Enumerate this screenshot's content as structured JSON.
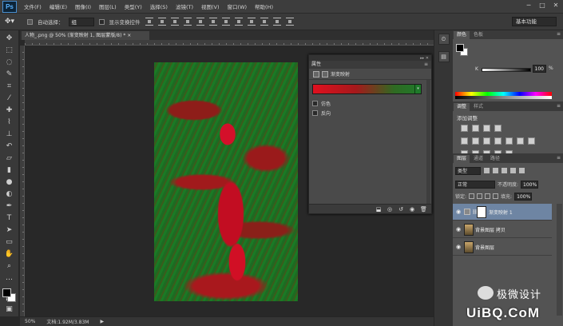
{
  "app": {
    "logo": "Ps"
  },
  "menu": [
    "文件(F)",
    "编辑(E)",
    "图像(I)",
    "图层(L)",
    "类型(Y)",
    "选择(S)",
    "滤镜(T)",
    "视图(V)",
    "窗口(W)",
    "帮助(H)"
  ],
  "window_controls": [
    "─",
    "□",
    "✕"
  ],
  "options": {
    "auto_select_label": "自动选择：",
    "auto_select_value": "组",
    "show_transform_label": "显示变换控件",
    "workspace": "基本功能"
  },
  "document": {
    "tab_title": "人物_.png @ 50% (渐变映射 1, 图层蒙版/8) * ×",
    "zoom": "50%",
    "doc_size": "文档:1.92M/3.83M"
  },
  "properties": {
    "panel_title": "属性",
    "adjustment_name": "渐变映射",
    "options": [
      {
        "label": "仿色",
        "checked": false
      },
      {
        "label": "反向",
        "checked": false
      }
    ],
    "gradient_colors": [
      "#e0101f",
      "#1f7a2a"
    ]
  },
  "color_panel": {
    "tabs": [
      "颜色",
      "色板"
    ],
    "channel_label": "K",
    "value": "100",
    "unit": "%"
  },
  "adjustments_panel": {
    "tabs": [
      "调整",
      "样式"
    ],
    "title": "添加调整"
  },
  "layers_panel": {
    "tabs": [
      "图层",
      "通道",
      "路径"
    ],
    "filter_kind": "类型",
    "blend_mode": "正常",
    "opacity_label": "不透明度:",
    "opacity_value": "100%",
    "lock_label": "锁定:",
    "fill_label": "填充:",
    "fill_value": "100%",
    "layers": [
      {
        "name": "渐变映射 1",
        "selected": true,
        "kind": "adjustment"
      },
      {
        "name": "背景图层 拷贝",
        "selected": false,
        "kind": "pixel"
      },
      {
        "name": "背景图层",
        "selected": false,
        "kind": "pixel"
      }
    ]
  },
  "watermark": {
    "brand": "极微设计",
    "site": "UiBQ.CoM"
  },
  "colors": {
    "accent_selected": "#6e85a3",
    "gradient_red": "#e0101f",
    "gradient_green": "#1f7a2a"
  }
}
